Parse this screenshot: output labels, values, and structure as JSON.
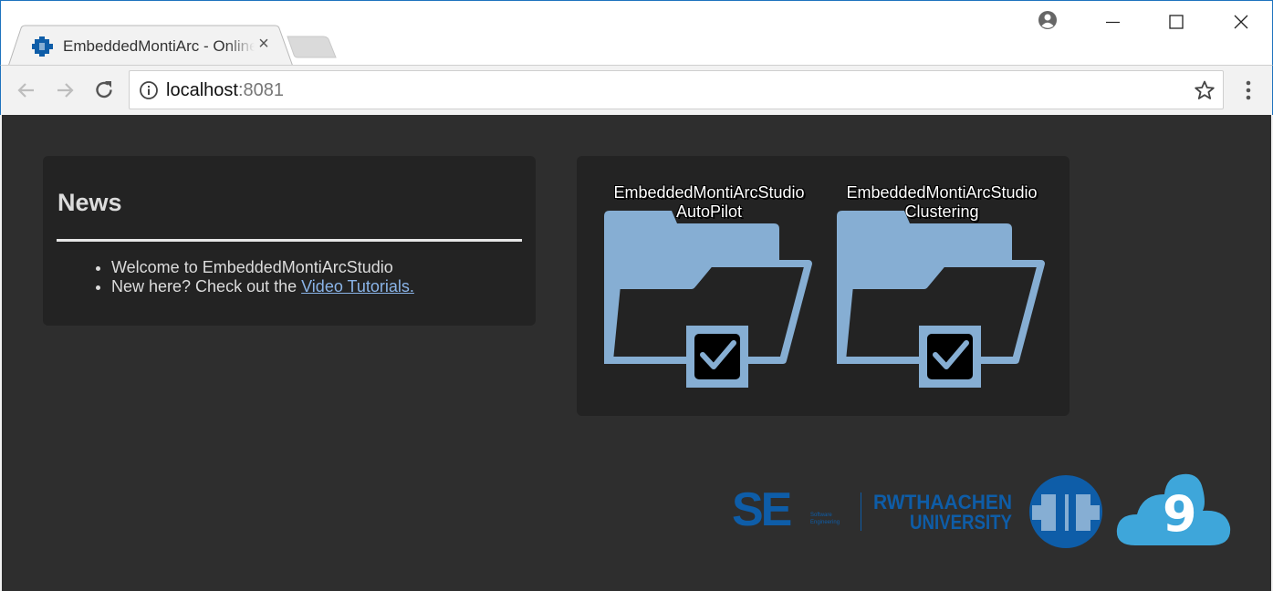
{
  "browser": {
    "tab_title": "EmbeddedMontiArc - Online IDE",
    "tab_close": "×",
    "url_host": "localhost",
    "url_port": ":8081"
  },
  "news": {
    "title": "News",
    "items": [
      {
        "text": "Welcome to EmbeddedMontiArcStudio"
      },
      {
        "text": "New here? Check out the ",
        "link": "Video Tutorials."
      }
    ]
  },
  "projects": [
    {
      "line1": "EmbeddedMontiArcStudio",
      "line2": "AutoPilot"
    },
    {
      "line1": "EmbeddedMontiArcStudio",
      "line2": "Clustering"
    }
  ],
  "logos": {
    "se_logo_text": "SE",
    "se_subtext": "Software Engineering",
    "rwth_line1": "RWTH AACHEN",
    "rwth_line2": "UNIVERSITY",
    "cloud9_text": "9"
  },
  "colors": {
    "folder": "#86aed3",
    "card_bg": "#232323",
    "page_bg": "#2e2e2e",
    "link": "#8ab4e8",
    "se_blue": "#0e5da8",
    "cloud9_blue": "#3ea6da"
  },
  "icons": {
    "back": "arrow-left-icon",
    "forward": "arrow-right-icon",
    "reload": "reload-icon",
    "info": "info-icon",
    "bookmark": "star-icon",
    "menu": "kebab-menu-icon",
    "profile": "profile-icon",
    "minimize": "minimize-icon",
    "maximize": "maximize-icon",
    "close": "close-icon",
    "folder": "folder-check-icon"
  }
}
